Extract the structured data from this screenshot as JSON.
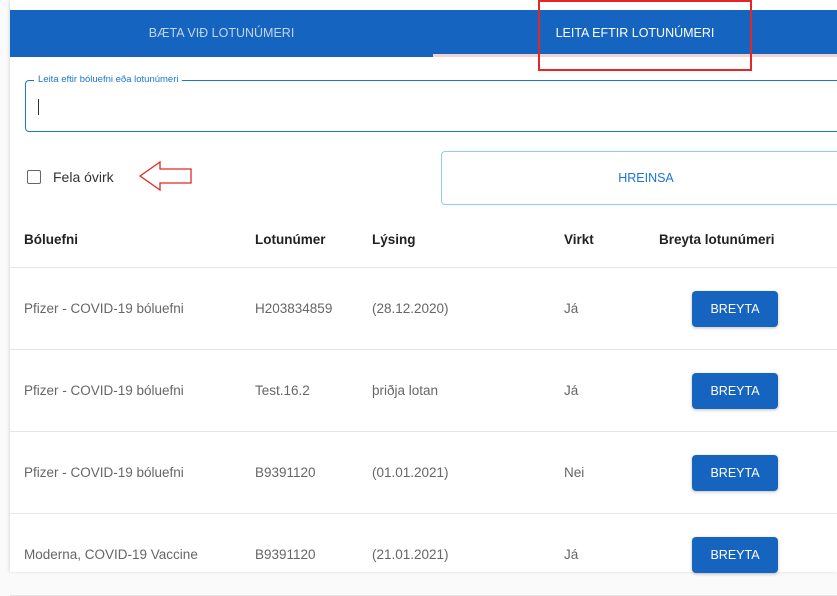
{
  "tabs": [
    {
      "label": "BÆTA VIÐ LOTUNÚMERI"
    },
    {
      "label": "LEITA EFTIR LOTUNÚMERI"
    }
  ],
  "search": {
    "label": "Leita eftir bóluefni eða lotunúmeri",
    "value": ""
  },
  "filter": {
    "checkbox_label": "Fela óvirk",
    "checked": false
  },
  "clear_button": "HREINSA",
  "table": {
    "headers": [
      "Bóluefni",
      "Lotunúmer",
      "Lýsing",
      "Virkt",
      "Breyta lotunúmeri"
    ],
    "rows": [
      {
        "vaccine": "Pfizer - COVID-19 bóluefni",
        "lot": "H203834859",
        "desc": "(28.12.2020)",
        "active": "Já",
        "action": "BREYTA"
      },
      {
        "vaccine": "Pfizer - COVID-19 bóluefni",
        "lot": "Test.16.2",
        "desc": "þriðja lotan",
        "active": "Já",
        "action": "BREYTA"
      },
      {
        "vaccine": "Pfizer - COVID-19 bóluefni",
        "lot": "B9391120",
        "desc": "(01.01.2021)",
        "active": "Nei",
        "action": "BREYTA"
      },
      {
        "vaccine": "Moderna, COVID-19 Vaccine",
        "lot": "B9391120",
        "desc": "(21.01.2021)",
        "active": "Já",
        "action": "BREYTA"
      }
    ]
  },
  "colors": {
    "primary": "#1565c0",
    "annotation": "#e32626"
  }
}
